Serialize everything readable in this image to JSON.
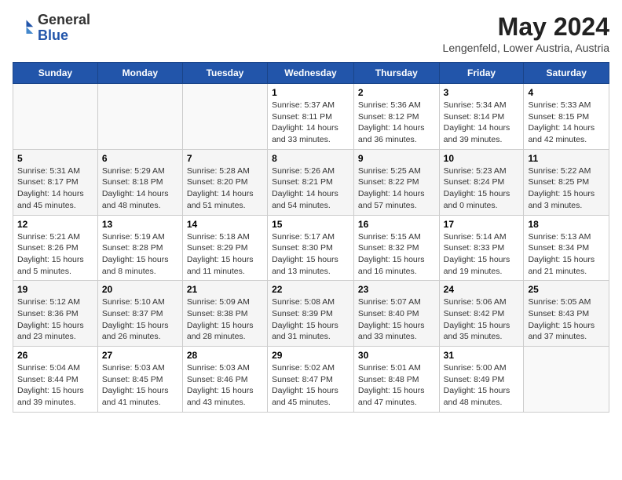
{
  "header": {
    "logo_general": "General",
    "logo_blue": "Blue",
    "month_year": "May 2024",
    "location": "Lengenfeld, Lower Austria, Austria"
  },
  "weekdays": [
    "Sunday",
    "Monday",
    "Tuesday",
    "Wednesday",
    "Thursday",
    "Friday",
    "Saturday"
  ],
  "weeks": [
    [
      {
        "day": "",
        "info": ""
      },
      {
        "day": "",
        "info": ""
      },
      {
        "day": "",
        "info": ""
      },
      {
        "day": "1",
        "info": "Sunrise: 5:37 AM\nSunset: 8:11 PM\nDaylight: 14 hours\nand 33 minutes."
      },
      {
        "day": "2",
        "info": "Sunrise: 5:36 AM\nSunset: 8:12 PM\nDaylight: 14 hours\nand 36 minutes."
      },
      {
        "day": "3",
        "info": "Sunrise: 5:34 AM\nSunset: 8:14 PM\nDaylight: 14 hours\nand 39 minutes."
      },
      {
        "day": "4",
        "info": "Sunrise: 5:33 AM\nSunset: 8:15 PM\nDaylight: 14 hours\nand 42 minutes."
      }
    ],
    [
      {
        "day": "5",
        "info": "Sunrise: 5:31 AM\nSunset: 8:17 PM\nDaylight: 14 hours\nand 45 minutes."
      },
      {
        "day": "6",
        "info": "Sunrise: 5:29 AM\nSunset: 8:18 PM\nDaylight: 14 hours\nand 48 minutes."
      },
      {
        "day": "7",
        "info": "Sunrise: 5:28 AM\nSunset: 8:20 PM\nDaylight: 14 hours\nand 51 minutes."
      },
      {
        "day": "8",
        "info": "Sunrise: 5:26 AM\nSunset: 8:21 PM\nDaylight: 14 hours\nand 54 minutes."
      },
      {
        "day": "9",
        "info": "Sunrise: 5:25 AM\nSunset: 8:22 PM\nDaylight: 14 hours\nand 57 minutes."
      },
      {
        "day": "10",
        "info": "Sunrise: 5:23 AM\nSunset: 8:24 PM\nDaylight: 15 hours\nand 0 minutes."
      },
      {
        "day": "11",
        "info": "Sunrise: 5:22 AM\nSunset: 8:25 PM\nDaylight: 15 hours\nand 3 minutes."
      }
    ],
    [
      {
        "day": "12",
        "info": "Sunrise: 5:21 AM\nSunset: 8:26 PM\nDaylight: 15 hours\nand 5 minutes."
      },
      {
        "day": "13",
        "info": "Sunrise: 5:19 AM\nSunset: 8:28 PM\nDaylight: 15 hours\nand 8 minutes."
      },
      {
        "day": "14",
        "info": "Sunrise: 5:18 AM\nSunset: 8:29 PM\nDaylight: 15 hours\nand 11 minutes."
      },
      {
        "day": "15",
        "info": "Sunrise: 5:17 AM\nSunset: 8:30 PM\nDaylight: 15 hours\nand 13 minutes."
      },
      {
        "day": "16",
        "info": "Sunrise: 5:15 AM\nSunset: 8:32 PM\nDaylight: 15 hours\nand 16 minutes."
      },
      {
        "day": "17",
        "info": "Sunrise: 5:14 AM\nSunset: 8:33 PM\nDaylight: 15 hours\nand 19 minutes."
      },
      {
        "day": "18",
        "info": "Sunrise: 5:13 AM\nSunset: 8:34 PM\nDaylight: 15 hours\nand 21 minutes."
      }
    ],
    [
      {
        "day": "19",
        "info": "Sunrise: 5:12 AM\nSunset: 8:36 PM\nDaylight: 15 hours\nand 23 minutes."
      },
      {
        "day": "20",
        "info": "Sunrise: 5:10 AM\nSunset: 8:37 PM\nDaylight: 15 hours\nand 26 minutes."
      },
      {
        "day": "21",
        "info": "Sunrise: 5:09 AM\nSunset: 8:38 PM\nDaylight: 15 hours\nand 28 minutes."
      },
      {
        "day": "22",
        "info": "Sunrise: 5:08 AM\nSunset: 8:39 PM\nDaylight: 15 hours\nand 31 minutes."
      },
      {
        "day": "23",
        "info": "Sunrise: 5:07 AM\nSunset: 8:40 PM\nDaylight: 15 hours\nand 33 minutes."
      },
      {
        "day": "24",
        "info": "Sunrise: 5:06 AM\nSunset: 8:42 PM\nDaylight: 15 hours\nand 35 minutes."
      },
      {
        "day": "25",
        "info": "Sunrise: 5:05 AM\nSunset: 8:43 PM\nDaylight: 15 hours\nand 37 minutes."
      }
    ],
    [
      {
        "day": "26",
        "info": "Sunrise: 5:04 AM\nSunset: 8:44 PM\nDaylight: 15 hours\nand 39 minutes."
      },
      {
        "day": "27",
        "info": "Sunrise: 5:03 AM\nSunset: 8:45 PM\nDaylight: 15 hours\nand 41 minutes."
      },
      {
        "day": "28",
        "info": "Sunrise: 5:03 AM\nSunset: 8:46 PM\nDaylight: 15 hours\nand 43 minutes."
      },
      {
        "day": "29",
        "info": "Sunrise: 5:02 AM\nSunset: 8:47 PM\nDaylight: 15 hours\nand 45 minutes."
      },
      {
        "day": "30",
        "info": "Sunrise: 5:01 AM\nSunset: 8:48 PM\nDaylight: 15 hours\nand 47 minutes."
      },
      {
        "day": "31",
        "info": "Sunrise: 5:00 AM\nSunset: 8:49 PM\nDaylight: 15 hours\nand 48 minutes."
      },
      {
        "day": "",
        "info": ""
      }
    ]
  ]
}
